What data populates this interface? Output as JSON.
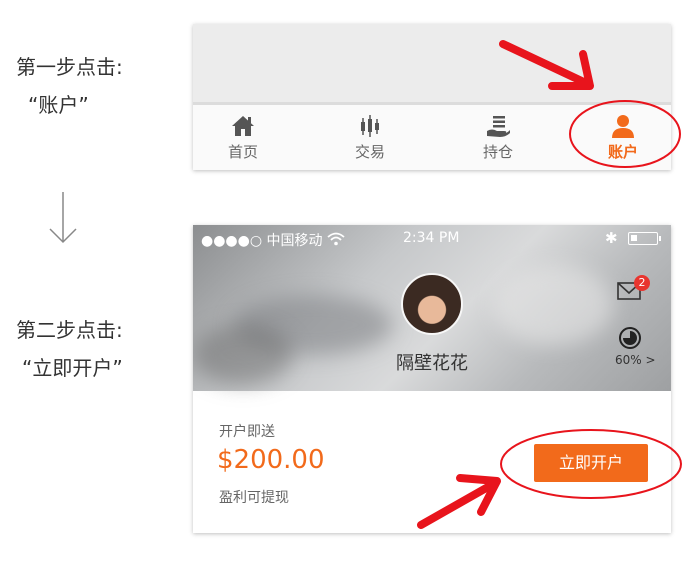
{
  "steps": {
    "step1_title": "第一步点击:",
    "step1_target": "“账户”",
    "step2_title": "第二步点击:",
    "step2_target": "“立即开户”"
  },
  "tabbar": {
    "items": [
      {
        "label": "首页",
        "icon": "home-icon"
      },
      {
        "label": "交易",
        "icon": "candlestick-icon"
      },
      {
        "label": "持仓",
        "icon": "hand-coins-icon"
      },
      {
        "label": "账户",
        "icon": "person-icon",
        "active": true
      }
    ],
    "active_color": "#f26a1b"
  },
  "statusbar": {
    "carrier": "●●●●○ 中国移动",
    "time": "2:34 PM"
  },
  "profile": {
    "username": "隔壁花花",
    "mail_badge": "2",
    "risk_level": "60%"
  },
  "offer": {
    "label": "开户即送",
    "amount": "$200.00",
    "note": "盈利可提现",
    "button_label": "立即开户"
  },
  "colors": {
    "accent": "#f26a1b",
    "annotation": "#e8141c"
  }
}
